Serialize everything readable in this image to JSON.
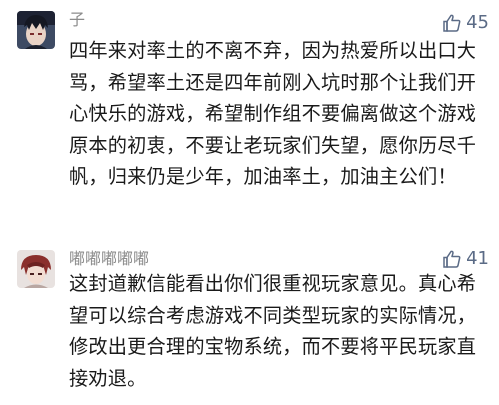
{
  "comments": [
    {
      "username": "子",
      "likes": "45",
      "avatar_icon": "dark-hair-character-avatar-icon",
      "text": "四年来对率土的不离不弃，因为热爱所以出口大骂，希望率土还是四年前刚入坑时那个让我们开心快乐的游戏，希望制作组不要偏离做这个游戏原本的初衷，不要让老玩家们失望，愿你历尽千帆，归来仍是少年，加油率土，加油主公们！"
    },
    {
      "username": "嘟嘟嘟嘟嘟",
      "likes": "41",
      "avatar_icon": "red-hair-character-avatar-icon",
      "text": "这封道歉信能看出你们很重视玩家意见。真心希望可以综合考虑游戏不同类型玩家的实际情况，修改出更合理的宝物系统，而不要将平民玩家直接劝退。"
    }
  ],
  "colors": {
    "username": "#8c8c8c",
    "like": "#5b6b86",
    "text": "#1a1a1a"
  }
}
